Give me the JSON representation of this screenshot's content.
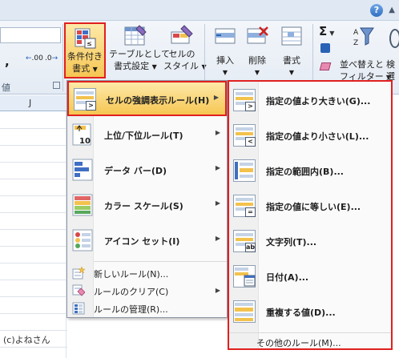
{
  "ribbon": {
    "group_label": "値",
    "conditional_formatting": {
      "line1": "条件付き",
      "line2": "書式"
    },
    "format_as_table": {
      "line1": "テーブルとして",
      "line2": "書式設定"
    },
    "cell_styles": {
      "line1": "セルの",
      "line2": "スタイル"
    },
    "insert": "挿入",
    "delete": "削除",
    "format": "書式",
    "autosum_symbol": "Σ",
    "sort_filter": {
      "line1": "並べ替えと",
      "line2": "フィルター"
    },
    "find_select": {
      "line1": "検",
      "line2": "選"
    },
    "comma_symbol": ",",
    "increase_decimal": ".00",
    "decrease_decimal": ".0",
    "help_symbol": "?"
  },
  "sheet": {
    "column_header": "J",
    "copyright": "(c)よねさん"
  },
  "menu": {
    "items": [
      {
        "label": "セルの強調表示ルール(H)",
        "icon": "highlight-cells-rules-icon",
        "highlighted": true,
        "has_submenu": true
      },
      {
        "label": "上位/下位ルール(T)",
        "icon": "top-bottom-rules-icon",
        "highlighted": false,
        "has_submenu": true
      },
      {
        "label": "データ バー(D)",
        "icon": "data-bars-icon",
        "highlighted": false,
        "has_submenu": true
      },
      {
        "label": "カラー スケール(S)",
        "icon": "color-scales-icon",
        "highlighted": false,
        "has_submenu": true
      },
      {
        "label": "アイコン セット(I)",
        "icon": "icon-sets-icon",
        "highlighted": false,
        "has_submenu": true
      }
    ],
    "small_items": [
      {
        "label": "新しいルール(N)...",
        "icon": "new-rule-icon"
      },
      {
        "label": "ルールのクリア(C)",
        "icon": "clear-rules-icon",
        "has_submenu": true
      },
      {
        "label": "ルールの管理(R)...",
        "icon": "manage-rules-icon"
      }
    ]
  },
  "submenu": {
    "items": [
      {
        "label": "指定の値より大きい(G)...",
        "badge": ">"
      },
      {
        "label": "指定の値より小さい(L)...",
        "badge": "<"
      },
      {
        "label": "指定の範囲内(B)...",
        "badge": ""
      },
      {
        "label": "指定の値に等しい(E)...",
        "badge": "="
      },
      {
        "label": "文字列(T)...",
        "badge": "ab"
      },
      {
        "label": "日付(A)...",
        "badge": ""
      },
      {
        "label": "重複する値(D)...",
        "badge": ""
      }
    ],
    "more_rules": "その他のルール(M)..."
  },
  "colors": {
    "highlight_border": "#e02020",
    "highlight_fill": "#f6c653",
    "ribbon_bg": "#e4ebf4"
  }
}
